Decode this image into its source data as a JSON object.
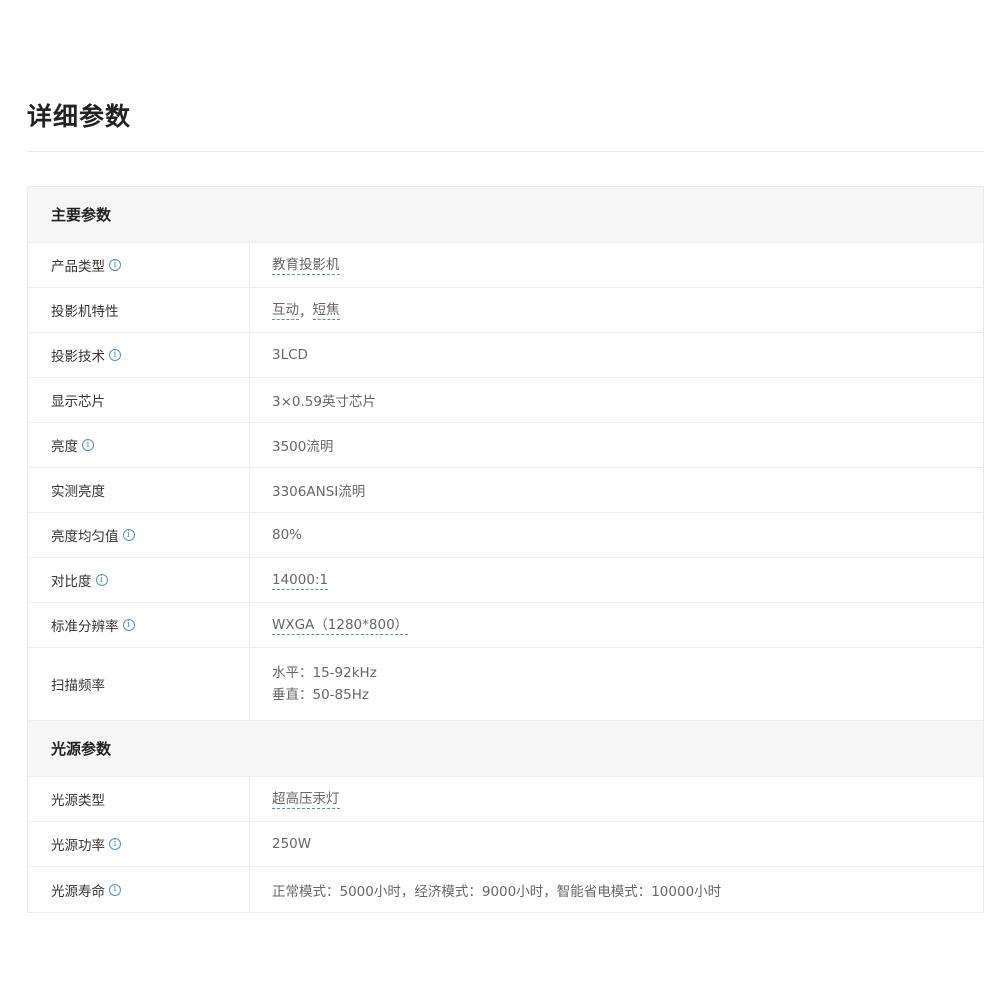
{
  "page_title": "详细参数",
  "icons": {
    "info": "info-circle-icon",
    "info_glyph": "i"
  },
  "colors": {
    "accent": "#4a90e2",
    "section_bg": "#f6f6f6",
    "border": "#eeeeee"
  },
  "sections": [
    {
      "title": "主要参数",
      "rows": [
        {
          "label": "产品类型",
          "has_info": true,
          "value": "教育投影机",
          "linked": true
        },
        {
          "label": "投影机特性",
          "has_info": false,
          "value_parts": [
            "互动",
            "，",
            "短焦"
          ],
          "linked": true
        },
        {
          "label": "投影技术",
          "has_info": true,
          "value": "3LCD",
          "linked": false
        },
        {
          "label": "显示芯片",
          "has_info": false,
          "value": "3×0.59英寸芯片",
          "linked": false
        },
        {
          "label": "亮度",
          "has_info": true,
          "value": "3500流明",
          "linked": false
        },
        {
          "label": "实测亮度",
          "has_info": false,
          "value": "3306ANSI流明",
          "linked": false
        },
        {
          "label": "亮度均匀值",
          "has_info": true,
          "value": "80%",
          "linked": false
        },
        {
          "label": "对比度",
          "has_info": true,
          "value": "14000:1",
          "linked": true
        },
        {
          "label": "标准分辨率",
          "has_info": true,
          "value": "WXGA（1280*800）",
          "linked": true
        },
        {
          "label": "扫描频率",
          "has_info": false,
          "value_lines": [
            "水平：15-92kHz",
            "垂直：50-85Hz"
          ],
          "linked": false
        }
      ]
    },
    {
      "title": "光源参数",
      "rows": [
        {
          "label": "光源类型",
          "has_info": false,
          "value": "超高压汞灯",
          "linked": true
        },
        {
          "label": "光源功率",
          "has_info": true,
          "value": "250W",
          "linked": false
        },
        {
          "label": "光源寿命",
          "has_info": true,
          "value": "正常模式：5000小时，经济模式：9000小时，智能省电模式：10000小时",
          "linked": false
        }
      ]
    }
  ]
}
